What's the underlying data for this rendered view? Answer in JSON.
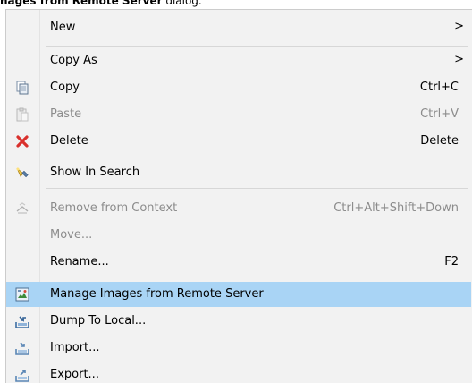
{
  "caption": {
    "bold": "nages from Remote Server",
    "rest": " dialog."
  },
  "menu": {
    "new": {
      "label": "New",
      "arrow": ">"
    },
    "copy_as": {
      "label": "Copy As",
      "arrow": ">"
    },
    "copy": {
      "label": "Copy",
      "accel": "Ctrl+C"
    },
    "paste": {
      "label": "Paste",
      "accel": "Ctrl+V"
    },
    "delete": {
      "label": "Delete",
      "accel": "Delete"
    },
    "show_in_search": {
      "label": "Show In Search"
    },
    "remove_from_context": {
      "label": "Remove from Context",
      "accel": "Ctrl+Alt+Shift+Down"
    },
    "move": {
      "label": "Move..."
    },
    "rename": {
      "label": "Rename...",
      "accel": "F2"
    },
    "manage_images": {
      "label": "Manage Images from Remote Server"
    },
    "dump_to_local": {
      "label": "Dump To Local..."
    },
    "import": {
      "label": "Import..."
    },
    "export": {
      "label": "Export..."
    }
  },
  "colors": {
    "hover": "#a9d4f5",
    "menu_bg": "#f2f2f2",
    "disabled_text": "#8c8c8c",
    "delete_red": "#d9302c"
  }
}
